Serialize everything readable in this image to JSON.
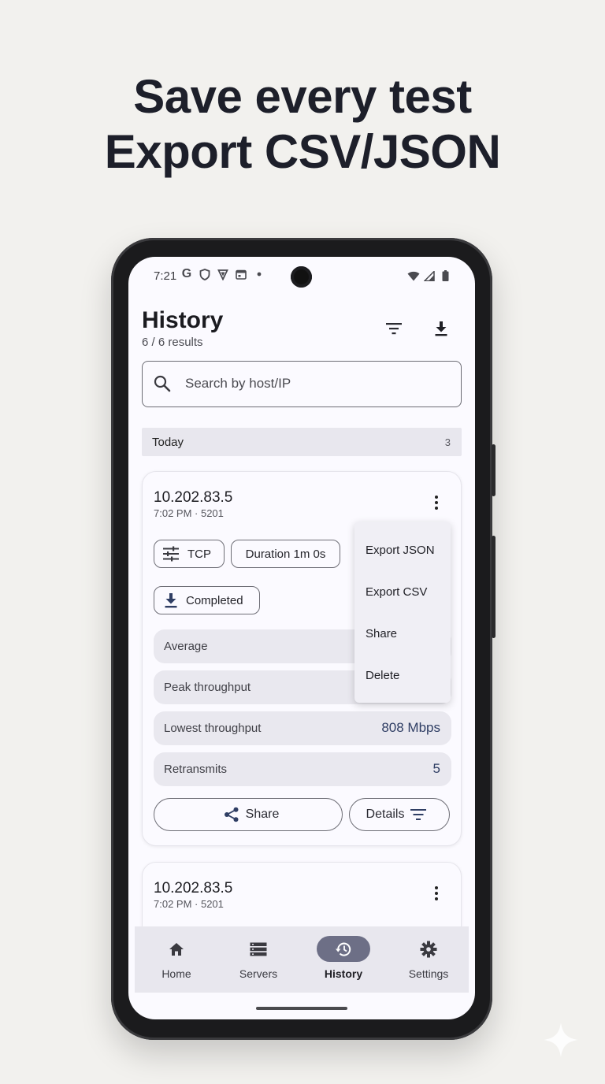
{
  "headline": {
    "line1": "Save every test",
    "line2": "Export CSV/JSON"
  },
  "status": {
    "time": "7:21"
  },
  "appbar": {
    "title": "History",
    "subtitle": "6 / 6 results"
  },
  "search": {
    "placeholder": "Search by host/IP",
    "value": ""
  },
  "section": {
    "label": "Today",
    "count": "3"
  },
  "card1": {
    "host": "10.202.83.5",
    "meta": "7:02 PM · 5201",
    "chips": {
      "protocol": "TCP",
      "duration": "Duration 1m 0s",
      "status": "Completed"
    },
    "metrics": [
      {
        "label": "Average",
        "value": ""
      },
      {
        "label": "Peak throughput",
        "value": ""
      },
      {
        "label": "Lowest throughput",
        "value": "808 Mbps"
      },
      {
        "label": "Retransmits",
        "value": "5"
      }
    ],
    "share_label": "Share",
    "details_label": "Details"
  },
  "menu": {
    "items": [
      "Export JSON",
      "Export CSV",
      "Share",
      "Delete"
    ]
  },
  "card2": {
    "host": "10.202.83.5",
    "meta": "7:02 PM · 5201"
  },
  "nav": {
    "items": [
      {
        "label": "Home",
        "icon": "home-icon"
      },
      {
        "label": "Servers",
        "icon": "servers-icon"
      },
      {
        "label": "History",
        "icon": "history-icon"
      },
      {
        "label": "Settings",
        "icon": "gear-icon"
      }
    ],
    "active": "History"
  },
  "colors": {
    "accent": "#2f3e64",
    "nav_active": "#6d6f86",
    "background": "#f2f1ee"
  }
}
